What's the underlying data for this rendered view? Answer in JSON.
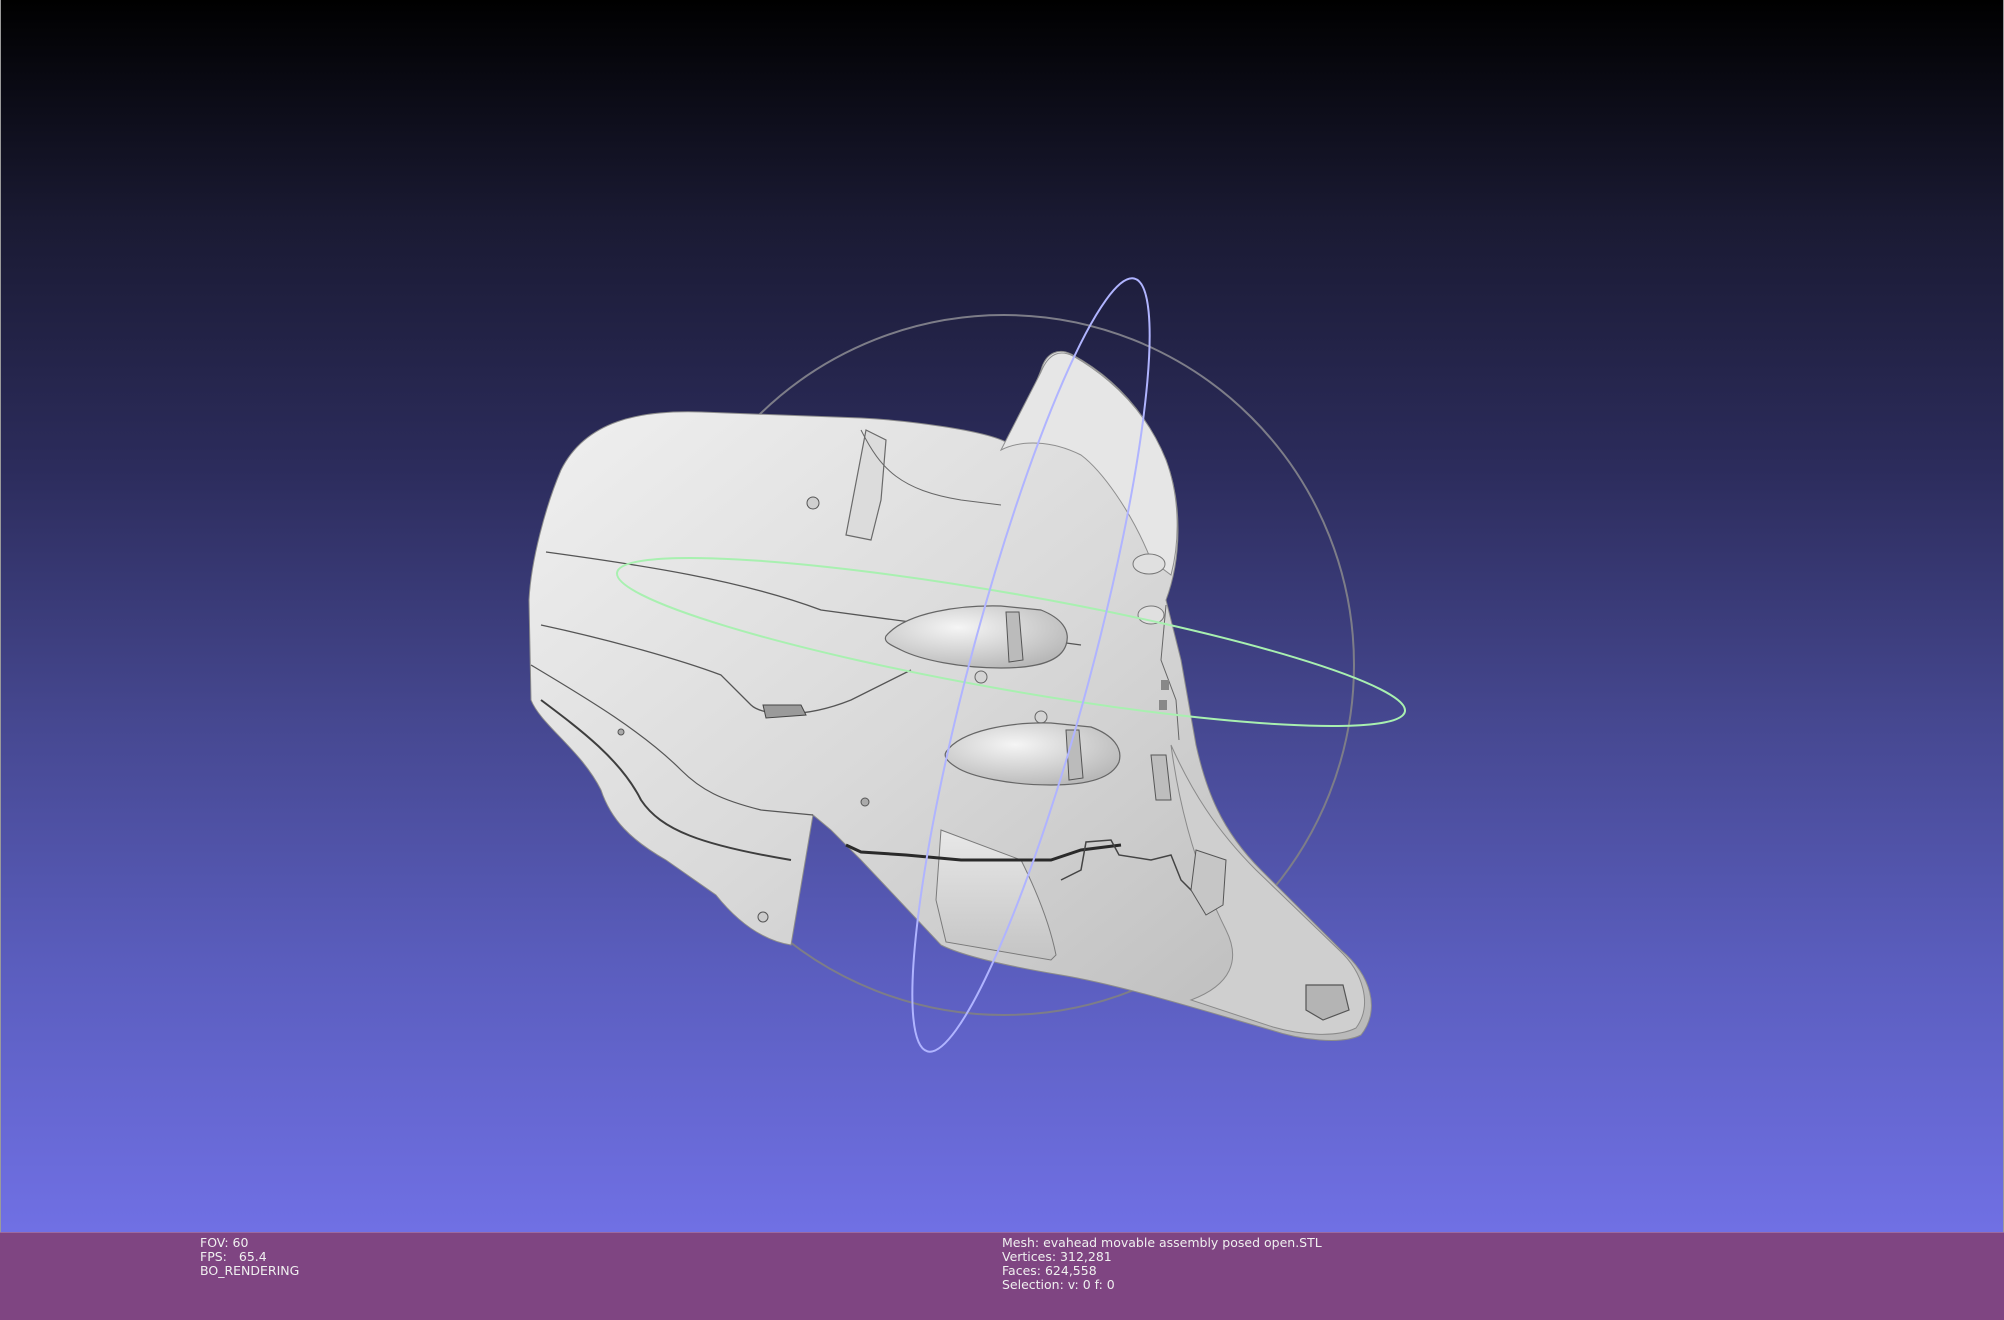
{
  "viewport": {
    "model": "evahead movable assembly posed open",
    "trackball_icon": "trackball-rotate-icon"
  },
  "info_left": {
    "fov": "FOV: 60",
    "fps_label": "FPS:",
    "fps_value": "65.4",
    "render_mode": "BO_RENDERING"
  },
  "info_right": {
    "mesh": "Mesh: evahead movable assembly posed open.STL",
    "vertices": "Vertices: 312,281",
    "faces": "Faces: 624,558",
    "selection": "Selection: v: 0 f: 0"
  },
  "colors": {
    "background_top": "#000000",
    "background_bottom": "#7070e4",
    "info_bar": "#7f4582",
    "mesh": "#d6d6d6"
  }
}
